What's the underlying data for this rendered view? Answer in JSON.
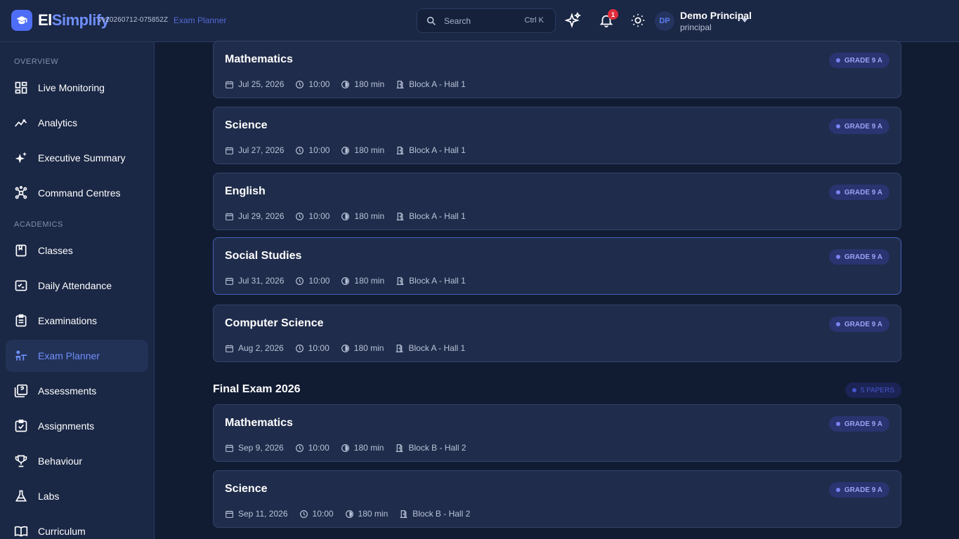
{
  "header": {
    "brand_a": "El",
    "brand_b": "Simplify",
    "version": "vv20260712-075852Z",
    "breadcrumb": "Exam Planner",
    "search_placeholder": "Search",
    "search_shortcut": "Ctrl K",
    "notification_count": "1",
    "user_initials": "DP",
    "user_name": "Demo Principal",
    "user_role": "principal"
  },
  "sidebar": {
    "sections": {
      "overview": "OVERVIEW",
      "academics": "ACADEMICS"
    },
    "items": [
      {
        "label": "Live Monitoring",
        "icon": "dashboard-icon"
      },
      {
        "label": "Analytics",
        "icon": "trend-icon"
      },
      {
        "label": "Executive Summary",
        "icon": "sparkle-icon"
      },
      {
        "label": "Command Centres",
        "icon": "hub-icon"
      },
      {
        "label": "Classes",
        "icon": "book-icon"
      },
      {
        "label": "Daily Attendance",
        "icon": "checklist-icon"
      },
      {
        "label": "Examinations",
        "icon": "clipboard-icon"
      },
      {
        "label": "Exam Planner",
        "icon": "desk-icon",
        "active": true
      },
      {
        "label": "Assessments",
        "icon": "quiz-icon"
      },
      {
        "label": "Assignments",
        "icon": "assignment-icon"
      },
      {
        "label": "Behaviour",
        "icon": "trophy-icon"
      },
      {
        "label": "Labs",
        "icon": "flask-icon"
      },
      {
        "label": "Curriculum",
        "icon": "open-book-icon"
      }
    ]
  },
  "exams_upper": [
    {
      "subject": "Mathematics",
      "date": "Jul 25, 2026",
      "time": "10:00",
      "duration": "180 min",
      "venue": "Block A - Hall 1",
      "grade": "GRADE 9 A"
    },
    {
      "subject": "Science",
      "date": "Jul 27, 2026",
      "time": "10:00",
      "duration": "180 min",
      "venue": "Block A - Hall 1",
      "grade": "GRADE 9 A"
    },
    {
      "subject": "English",
      "date": "Jul 29, 2026",
      "time": "10:00",
      "duration": "180 min",
      "venue": "Block A - Hall 1",
      "grade": "GRADE 9 A"
    },
    {
      "subject": "Social Studies",
      "date": "Jul 31, 2026",
      "time": "10:00",
      "duration": "180 min",
      "venue": "Block A - Hall 1",
      "grade": "GRADE 9 A"
    },
    {
      "subject": "Computer Science",
      "date": "Aug 2, 2026",
      "time": "10:00",
      "duration": "180 min",
      "venue": "Block A - Hall 1",
      "grade": "GRADE 9 A"
    }
  ],
  "final_exam": {
    "title": "Final Exam 2026",
    "papers": "5 PAPERS",
    "exams": [
      {
        "subject": "Mathematics",
        "date": "Sep 9, 2026",
        "time": "10:00",
        "duration": "180 min",
        "venue": "Block B - Hall 2",
        "grade": "GRADE 9 A"
      },
      {
        "subject": "Science",
        "date": "Sep 11, 2026",
        "time": "10:00",
        "duration": "180 min",
        "venue": "Block B - Hall 2",
        "grade": "GRADE 9 A"
      }
    ]
  },
  "colors": {
    "accent": "#6f8ef9",
    "background": "#111c33",
    "surface": "#1f2c4b",
    "badge": "#e02d3c"
  }
}
